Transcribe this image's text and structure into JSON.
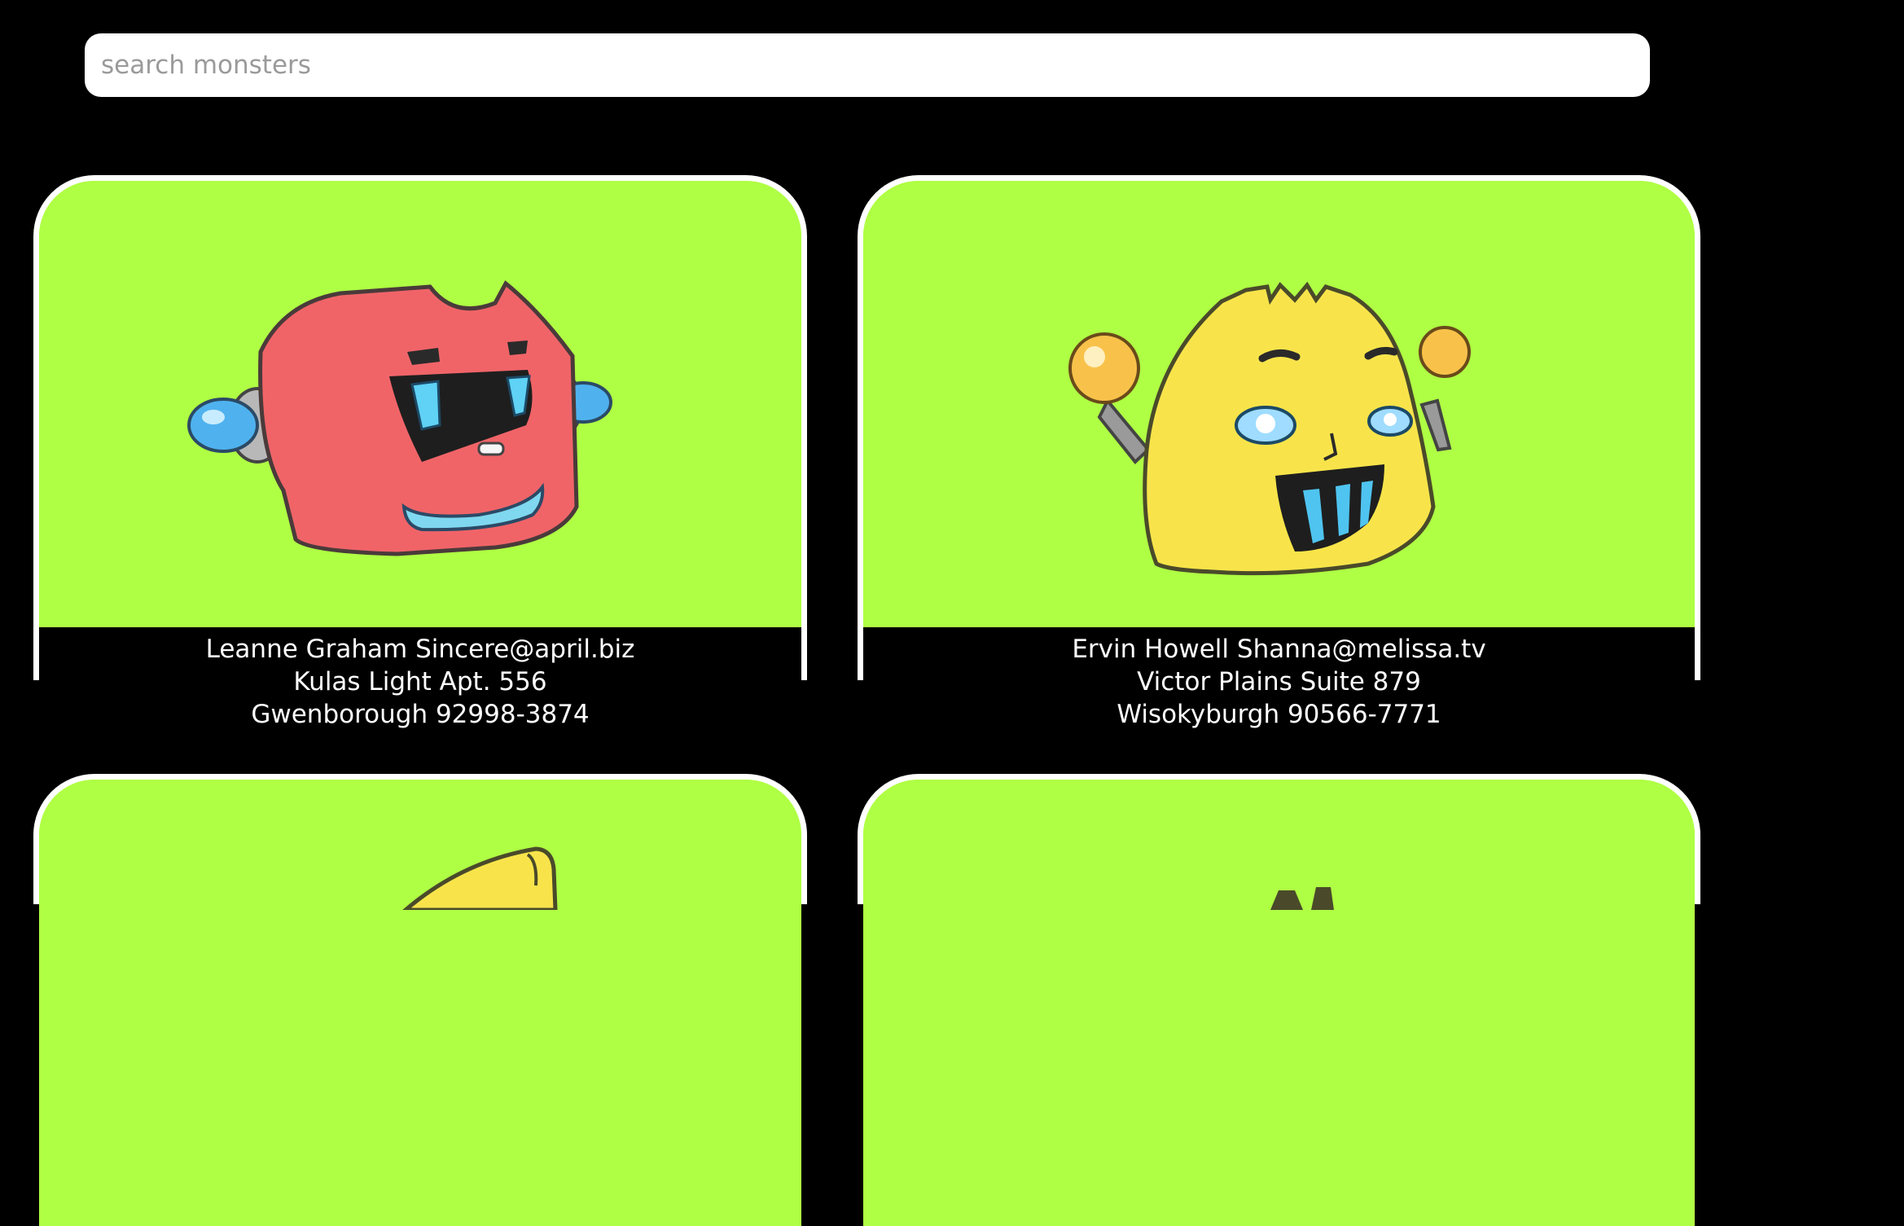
{
  "search": {
    "placeholder": "search monsters",
    "value": ""
  },
  "colors": {
    "background": "#000000",
    "card_background": "#afff44",
    "card_border": "#ffffff",
    "text": "#ffffff"
  },
  "monsters": [
    {
      "name": "Leanne Graham",
      "email": "Sincere@april.biz",
      "street": "Kulas Light",
      "suite": "Apt. 556",
      "city": "Gwenborough",
      "zipcode": "92998-3874",
      "avatar": "red-robot-monster"
    },
    {
      "name": "Ervin Howell",
      "email": "Shanna@melissa.tv",
      "street": "Victor Plains",
      "suite": "Suite 879",
      "city": "Wisokyburgh",
      "zipcode": "90566-7771",
      "avatar": "yellow-robot-monster"
    },
    {
      "avatar": "yellow-robot-monster-partial"
    },
    {
      "avatar": "robot-monster-partial"
    }
  ]
}
